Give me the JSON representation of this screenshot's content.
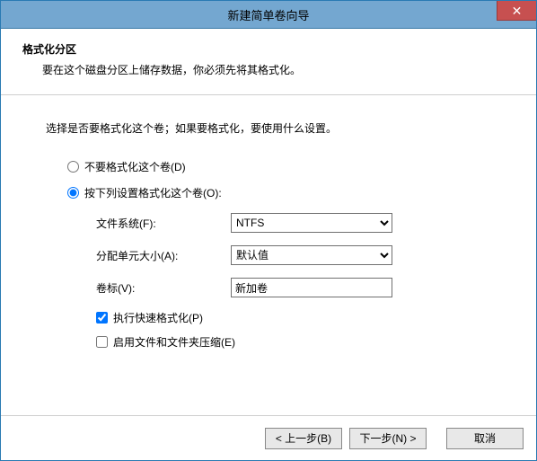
{
  "window": {
    "title": "新建简单卷向导",
    "close_label": "✕"
  },
  "header": {
    "title": "格式化分区",
    "subtitle": "要在这个磁盘分区上储存数据，你必须先将其格式化。"
  },
  "body": {
    "instruction": "选择是否要格式化这个卷；如果要格式化，要使用什么设置。",
    "radio_noformat": "不要格式化这个卷(D)",
    "radio_format": "按下列设置格式化这个卷(O):",
    "fs_label": "文件系统(F):",
    "fs_value": "NTFS",
    "au_label": "分配单元大小(A):",
    "au_value": "默认值",
    "vol_label": "卷标(V):",
    "vol_value": "新加卷",
    "quick_label": "执行快速格式化(P)",
    "compress_label": "启用文件和文件夹压缩(E)"
  },
  "footer": {
    "back": "< 上一步(B)",
    "next": "下一步(N) >",
    "cancel": "取消"
  }
}
